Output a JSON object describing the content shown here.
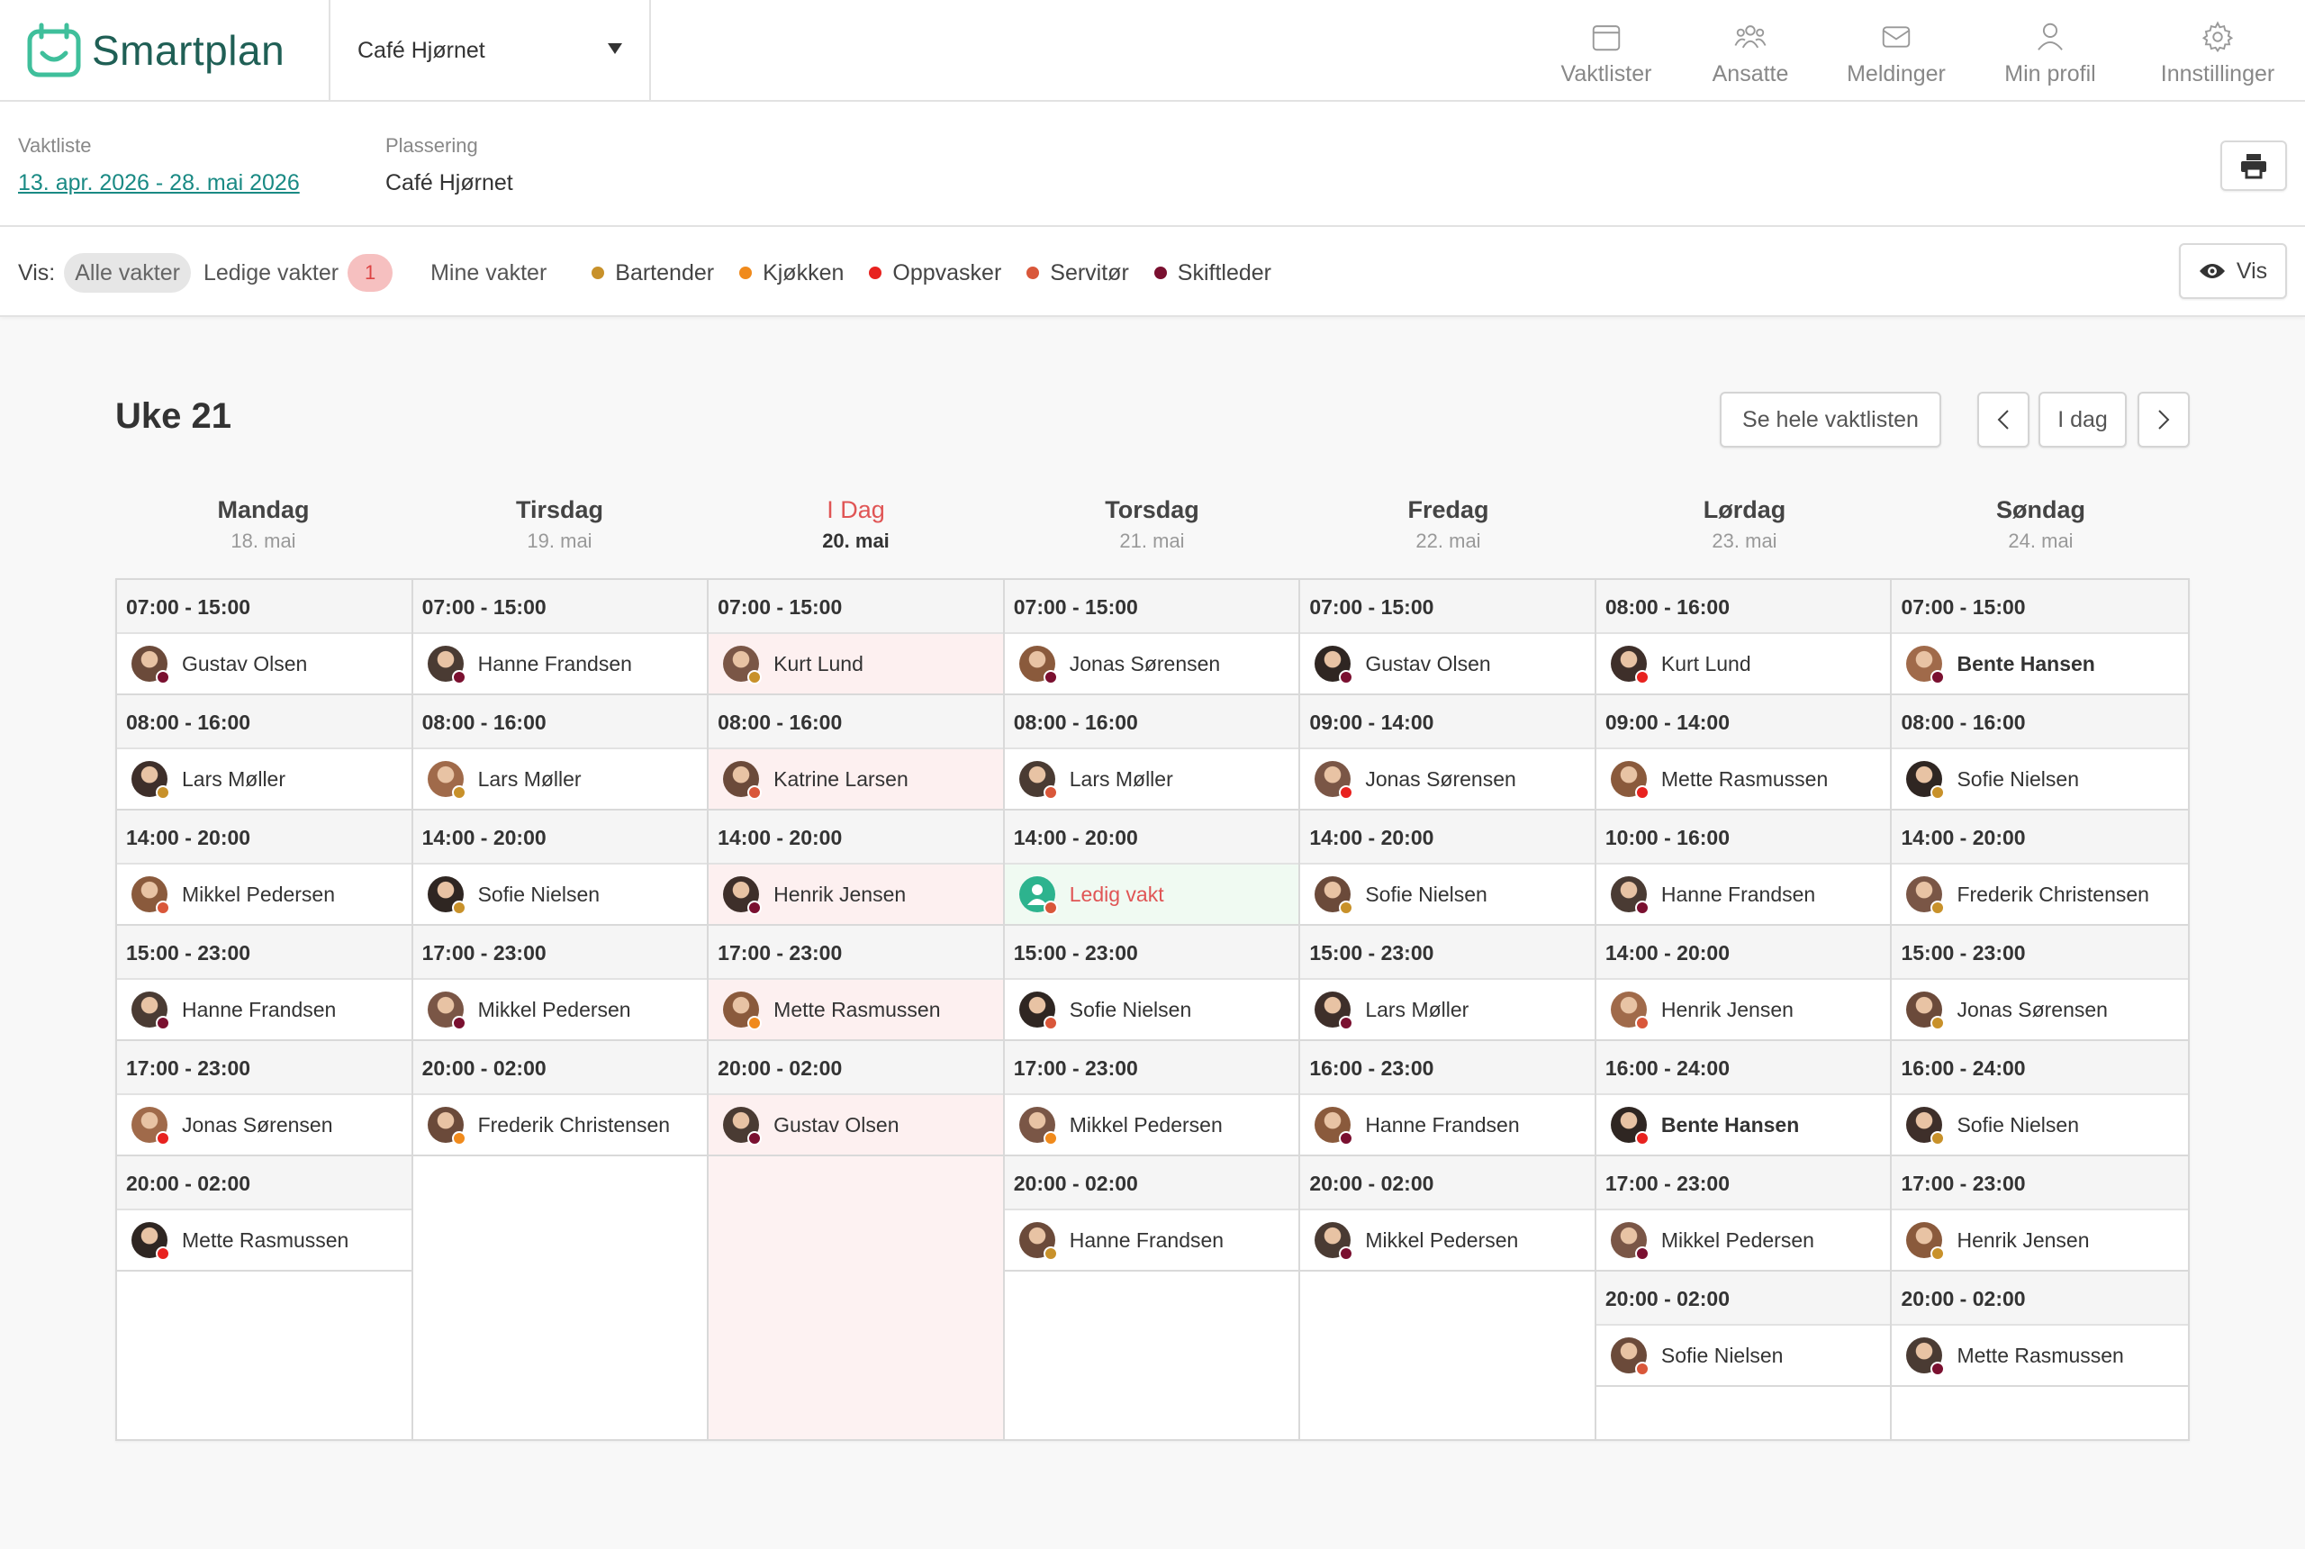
{
  "app": {
    "name": "Smartplan",
    "location": "Café Hjørnet"
  },
  "nav": [
    {
      "label": "Vaktlister",
      "icon": "calendar-icon"
    },
    {
      "label": "Ansatte",
      "icon": "users-icon"
    },
    {
      "label": "Meldinger",
      "icon": "mail-icon"
    },
    {
      "label": "Min profil",
      "icon": "user-icon"
    },
    {
      "label": "Innstillinger",
      "icon": "gear-icon"
    }
  ],
  "info": {
    "roster_label": "Vaktliste",
    "roster_value": "13. apr. 2026 - 28. mai 2026",
    "location_label": "Plassering",
    "location_value": "Café Hjørnet"
  },
  "filters": {
    "label": "Vis:",
    "all": "Alle vakter",
    "open": "Ledige vakter",
    "open_count": "1",
    "mine": "Mine vakter",
    "vis_button": "Vis"
  },
  "roles": [
    {
      "name": "Bartender",
      "color": "#c8912a"
    },
    {
      "name": "Kjøkken",
      "color": "#f08a1c"
    },
    {
      "name": "Oppvasker",
      "color": "#e8221f"
    },
    {
      "name": "Servitør",
      "color": "#d9573a"
    },
    {
      "name": "Skiftleder",
      "color": "#7a1030"
    }
  ],
  "week": {
    "title": "Uke 21",
    "see_all": "Se hele vaktlisten",
    "today": "I dag"
  },
  "days": [
    {
      "name": "Mandag",
      "date": "18. mai",
      "today": false,
      "slots": [
        {
          "time": "07:00 - 15:00",
          "person": "Gustav Olsen",
          "role": 4
        },
        {
          "time": "08:00 - 16:00",
          "person": "Lars Møller",
          "role": 0
        },
        {
          "time": "14:00 - 20:00",
          "person": "Mikkel Pedersen",
          "role": 3
        },
        {
          "time": "15:00 - 23:00",
          "person": "Hanne Frandsen",
          "role": 4
        },
        {
          "time": "17:00 - 23:00",
          "person": "Jonas Sørensen",
          "role": 2
        },
        {
          "time": "20:00 - 02:00",
          "person": "Mette Rasmussen",
          "role": 2
        }
      ]
    },
    {
      "name": "Tirsdag",
      "date": "19. mai",
      "today": false,
      "slots": [
        {
          "time": "07:00 - 15:00",
          "person": "Hanne Frandsen",
          "role": 4
        },
        {
          "time": "08:00 - 16:00",
          "person": "Lars Møller",
          "role": 0
        },
        {
          "time": "14:00 - 20:00",
          "person": "Sofie Nielsen",
          "role": 0
        },
        {
          "time": "17:00 - 23:00",
          "person": "Mikkel Pedersen",
          "role": 4
        },
        {
          "time": "20:00 - 02:00",
          "person": "Frederik Christensen",
          "role": 1
        }
      ]
    },
    {
      "name": "I Dag",
      "date": "20. mai",
      "today": true,
      "slots": [
        {
          "time": "07:00 - 15:00",
          "person": "Kurt Lund",
          "role": 0
        },
        {
          "time": "08:00 - 16:00",
          "person": "Katrine Larsen",
          "role": 3
        },
        {
          "time": "14:00 - 20:00",
          "person": "Henrik Jensen",
          "role": 4
        },
        {
          "time": "17:00 - 23:00",
          "person": "Mette Rasmussen",
          "role": 1
        },
        {
          "time": "20:00 - 02:00",
          "person": "Gustav Olsen",
          "role": 4
        }
      ]
    },
    {
      "name": "Torsdag",
      "date": "21. mai",
      "today": false,
      "slots": [
        {
          "time": "07:00 - 15:00",
          "person": "Jonas Sørensen",
          "role": 4
        },
        {
          "time": "08:00 - 16:00",
          "person": "Lars Møller",
          "role": 3
        },
        {
          "time": "14:00 - 20:00",
          "person": "Ledig vakt",
          "role": 3,
          "open": true
        },
        {
          "time": "15:00 - 23:00",
          "person": "Sofie Nielsen",
          "role": 3
        },
        {
          "time": "17:00 - 23:00",
          "person": "Mikkel Pedersen",
          "role": 1
        },
        {
          "time": "20:00 - 02:00",
          "person": "Hanne Frandsen",
          "role": 0
        }
      ]
    },
    {
      "name": "Fredag",
      "date": "22. mai",
      "today": false,
      "slots": [
        {
          "time": "07:00 - 15:00",
          "person": "Gustav Olsen",
          "role": 4
        },
        {
          "time": "09:00 - 14:00",
          "person": "Jonas Sørensen",
          "role": 2
        },
        {
          "time": "14:00 - 20:00",
          "person": "Sofie Nielsen",
          "role": 0
        },
        {
          "time": "15:00 - 23:00",
          "person": "Lars Møller",
          "role": 4
        },
        {
          "time": "16:00 - 23:00",
          "person": "Hanne Frandsen",
          "role": 4
        },
        {
          "time": "20:00 - 02:00",
          "person": "Mikkel Pedersen",
          "role": 4
        }
      ]
    },
    {
      "name": "Lørdag",
      "date": "23. mai",
      "today": false,
      "slots": [
        {
          "time": "08:00 - 16:00",
          "person": "Kurt Lund",
          "role": 2
        },
        {
          "time": "09:00 - 14:00",
          "person": "Mette Rasmussen",
          "role": 2
        },
        {
          "time": "10:00 - 16:00",
          "person": "Hanne Frandsen",
          "role": 4
        },
        {
          "time": "14:00 - 20:00",
          "person": "Henrik Jensen",
          "role": 3
        },
        {
          "time": "16:00 - 24:00",
          "person": "Bente Hansen",
          "role": 2,
          "bold": true
        },
        {
          "time": "17:00 - 23:00",
          "person": "Mikkel Pedersen",
          "role": 4
        },
        {
          "time": "20:00 - 02:00",
          "person": "Sofie Nielsen",
          "role": 3
        }
      ]
    },
    {
      "name": "Søndag",
      "date": "24. mai",
      "today": false,
      "slots": [
        {
          "time": "07:00 - 15:00",
          "person": "Bente Hansen",
          "role": 4,
          "bold": true
        },
        {
          "time": "08:00 - 16:00",
          "person": "Sofie Nielsen",
          "role": 0
        },
        {
          "time": "14:00 - 20:00",
          "person": "Frederik Christensen",
          "role": 0
        },
        {
          "time": "15:00 - 23:00",
          "person": "Jonas Sørensen",
          "role": 0
        },
        {
          "time": "16:00 - 24:00",
          "person": "Sofie Nielsen",
          "role": 0
        },
        {
          "time": "17:00 - 23:00",
          "person": "Henrik Jensen",
          "role": 0
        },
        {
          "time": "20:00 - 02:00",
          "person": "Mette Rasmussen",
          "role": 4
        }
      ]
    }
  ],
  "colors": {
    "accent": "#1a8a84",
    "brand": "#1f5f55",
    "today": "#e05555",
    "open_shift": "#e05555",
    "open_avatar": "#2db38e"
  }
}
